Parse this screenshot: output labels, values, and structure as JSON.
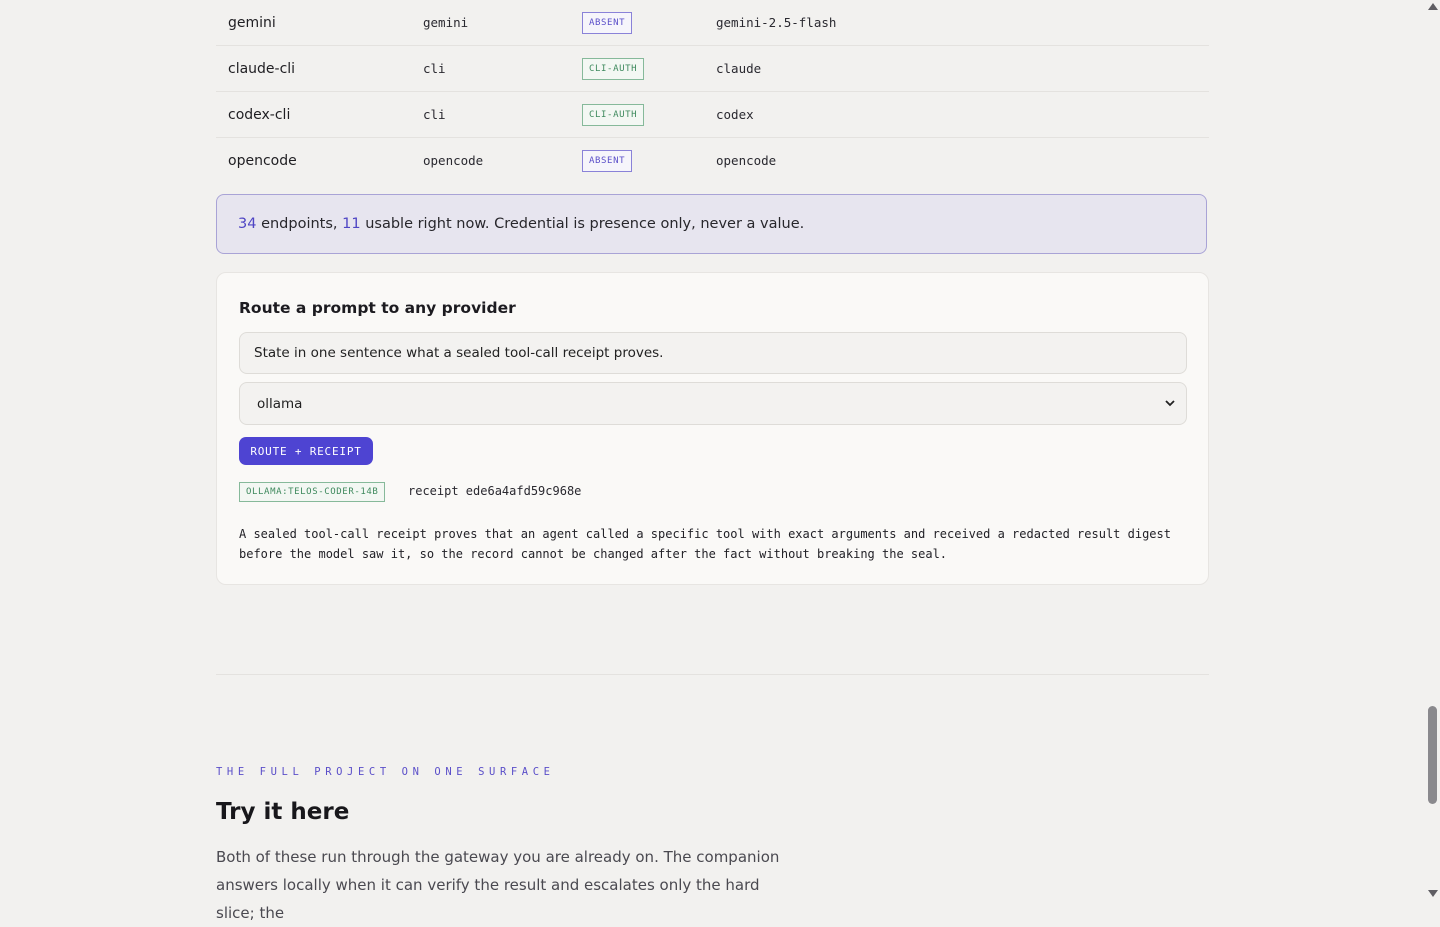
{
  "providers": [
    {
      "name": "gemini",
      "kind": "gemini",
      "status": "ABSENT",
      "model": "gemini-2.5-flash"
    },
    {
      "name": "claude-cli",
      "kind": "cli",
      "status": "CLI-AUTH",
      "model": "claude"
    },
    {
      "name": "codex-cli",
      "kind": "cli",
      "status": "CLI-AUTH",
      "model": "codex"
    },
    {
      "name": "opencode",
      "kind": "opencode",
      "status": "ABSENT",
      "model": "opencode"
    }
  ],
  "summary": {
    "endpoints": "34",
    "endpoints_label": "endpoints,",
    "usable": "11",
    "usable_label": "usable right now. Credential is presence only, never a value."
  },
  "route_card": {
    "title": "Route a prompt to any provider",
    "prompt_value": "State in one sentence what a sealed tool-call receipt proves.",
    "selected_provider": "ollama",
    "button_label": "ROUTE + RECEIPT",
    "model_tag": "OLLAMA:TELOS-CODER-14B",
    "receipt": "receipt ede6a4afd59c968e",
    "result": "A sealed tool-call receipt proves that an agent called a specific tool with exact arguments and received a redacted result digest before the model saw it, so the record cannot be changed after the fact without breaking the seal."
  },
  "section": {
    "eyebrow": "THE FULL PROJECT ON ONE SURFACE",
    "title": "Try it here",
    "body": "Both of these run through the gateway you are already on. The companion answers locally when it can verify the result and escalates only the hard slice; the"
  },
  "colors": {
    "accent": "#4e44d2",
    "absent": "#5b4fc9",
    "cli_auth": "#3f8a5e"
  }
}
